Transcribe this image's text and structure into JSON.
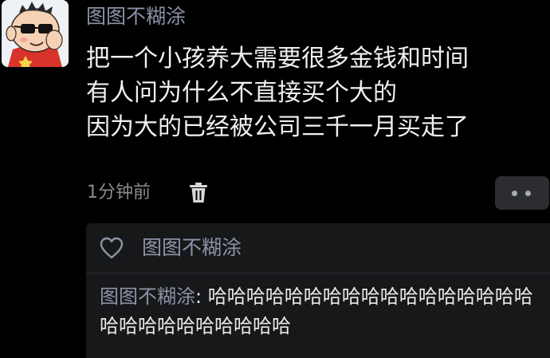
{
  "post": {
    "avatar_icon": "cartoon-boy-avatar",
    "author": "图图不糊涂",
    "lines": [
      "把一个小孩养大需要很多金钱和时间",
      "有人问为什么不直接买个大的",
      "因为大的已经被公司三千一月买走了"
    ],
    "time": "1分钟前",
    "delete_icon": "trash-icon",
    "more_icon": "more-dots-icon"
  },
  "likes": {
    "icon": "heart-icon",
    "names": "图图不糊涂"
  },
  "comment": {
    "author": "图图不糊涂",
    "separator": ": ",
    "text": "哈哈哈哈哈哈哈哈哈哈哈哈哈哈哈哈哈哈哈哈哈哈哈哈哈哈哈"
  },
  "colors": {
    "background": "#000000",
    "name_link": "#8c93a6",
    "body_text": "#f0f0f0",
    "secondary_text": "#8b8b8b",
    "comment_panel": "#17181a",
    "more_button": "#2b2d31"
  }
}
